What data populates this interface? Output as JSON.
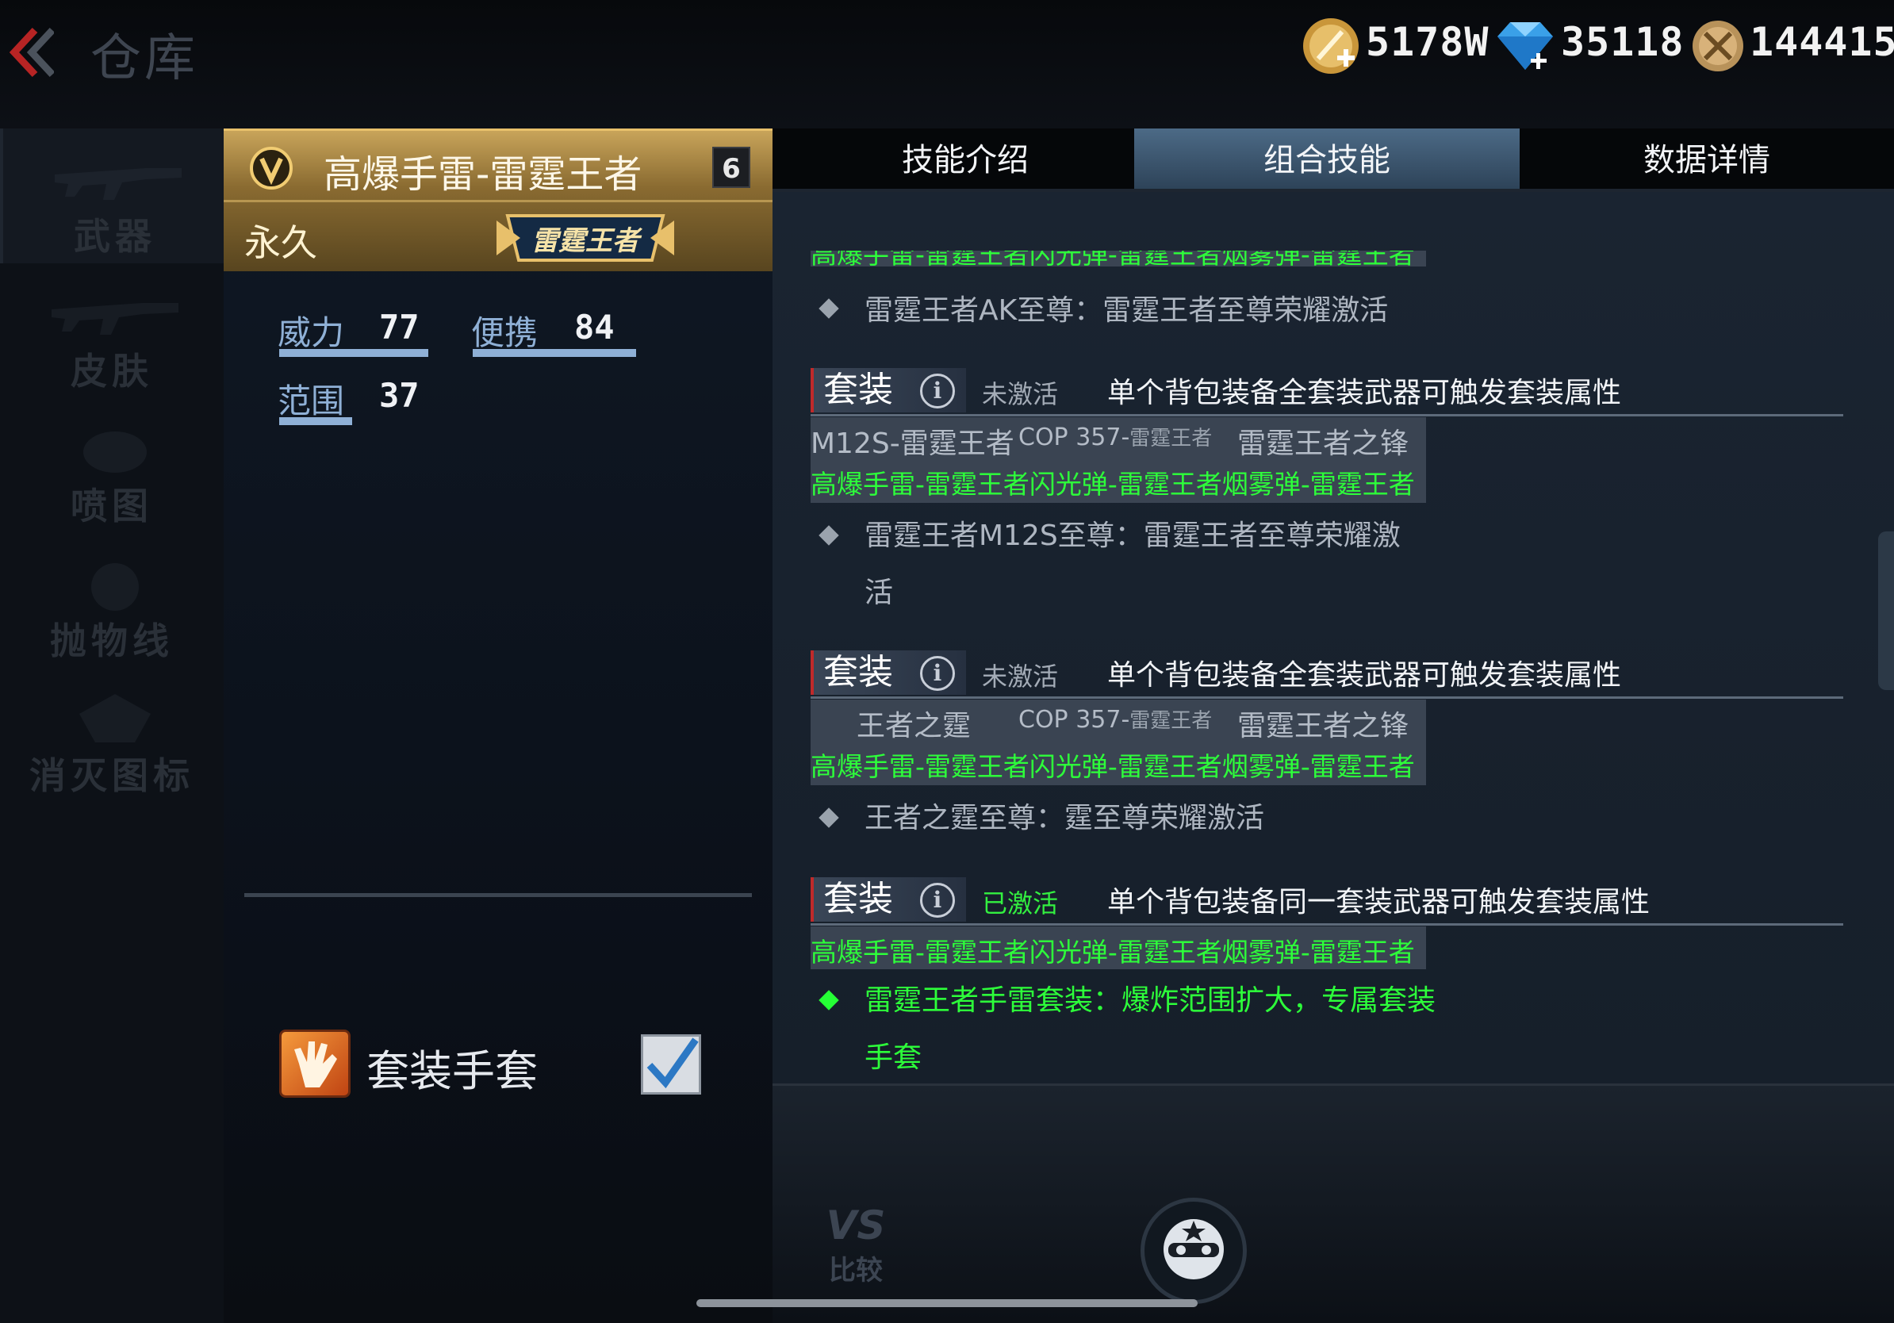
{
  "header": {
    "title": "仓库",
    "currencies": [
      {
        "icon": "gold-coin-icon",
        "value": "5178W"
      },
      {
        "icon": "diamond-icon",
        "value": "35118"
      },
      {
        "icon": "honor-medal-icon",
        "value": "144415"
      }
    ]
  },
  "sidebar": {
    "items": [
      {
        "label": "武器",
        "icon": "rifle-icon"
      },
      {
        "label": "皮肤",
        "icon": "rifle-skin-icon"
      },
      {
        "label": "喷图",
        "icon": "spray-icon"
      },
      {
        "label": "抛物线",
        "icon": "trajectory-icon"
      },
      {
        "label": "消灭图标",
        "icon": "kill-icon"
      }
    ]
  },
  "item": {
    "name": "高爆手雷-雷霆王者",
    "level": "6",
    "duration": "永久",
    "series_badge": "雷霆王者",
    "stats": [
      {
        "label": "威力",
        "value": "77"
      },
      {
        "label": "便携",
        "value": "84"
      },
      {
        "label": "范围",
        "value": "37"
      }
    ],
    "glove_label": "套装手套",
    "glove_checked": true
  },
  "tabs": [
    {
      "label": "技能介绍",
      "active": false
    },
    {
      "label": "组合技能",
      "active": true
    },
    {
      "label": "数据详情",
      "active": false
    }
  ],
  "sets": {
    "cut_top_text": "高爆手雷-雷霆王者闪光弹-雷霆王者烟雾弹-雷霆王者",
    "top_bonus": "雷霆王者AK至尊：雷霆王者至尊荣耀激活",
    "set1": {
      "tag": "套装",
      "status": "未激活",
      "desc": "单个背包装备全套装武器可触发套装属性",
      "row1": {
        "a": "M12S-雷霆王者",
        "b": "COP 357-",
        "b_small": "雷霆王者",
        "c": "雷霆王者之锋"
      },
      "row2": "高爆手雷-雷霆王者闪光弹-雷霆王者烟雾弹-雷霆王者",
      "bonus_line1": "雷霆王者M12S至尊：雷霆王者至尊荣耀激",
      "bonus_line2": "活"
    },
    "set2": {
      "tag": "套装",
      "status": "未激活",
      "desc": "单个背包装备全套装武器可触发套装属性",
      "row1": {
        "a": "王者之霆",
        "b": "COP 357-",
        "b_small": "雷霆王者",
        "c": "雷霆王者之锋"
      },
      "row2": "高爆手雷-雷霆王者闪光弹-雷霆王者烟雾弹-雷霆王者",
      "bonus": "王者之霆至尊：霆至尊荣耀激活"
    },
    "set3": {
      "tag": "套装",
      "status": "已激活",
      "desc": "单个背包装备同一套装武器可触发套装属性",
      "row1": "高爆手雷-雷霆王者闪光弹-雷霆王者烟雾弹-雷霆王者",
      "bonus_line1": "雷霆王者手雷套装：爆炸范围扩大，专属套装",
      "bonus_line2": "手套"
    }
  },
  "bottom": {
    "vs_top": "VS",
    "vs_bottom": "比较"
  },
  "colors": {
    "active_green": "#2dff3a",
    "gold": "#c8a45a",
    "stat_blue": "#8fb0d6"
  }
}
